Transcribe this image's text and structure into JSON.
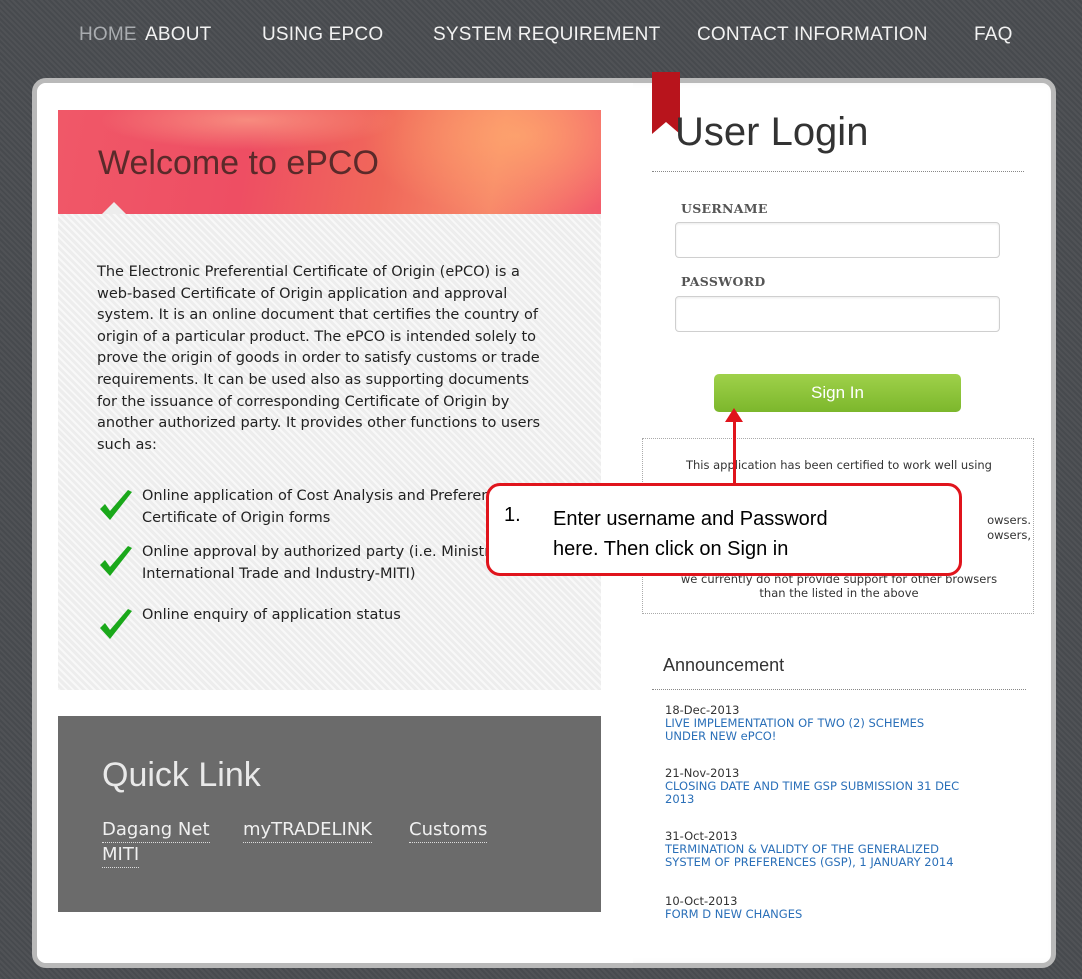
{
  "nav": {
    "items": [
      {
        "label": "HOME",
        "active": true
      },
      {
        "label": "ABOUT"
      },
      {
        "label": "USING EPCO"
      },
      {
        "label": "SYSTEM REQUIREMENT"
      },
      {
        "label": "CONTACT INFORMATION"
      },
      {
        "label": "FAQ"
      }
    ]
  },
  "welcome": {
    "title": "Welcome to ePCO",
    "lines": [
      "The Electronic Preferential Certificate of Origin (ePCO) is a",
      "web-based Certificate of Origin application and approval",
      "system. It is an online document that certifies the country of",
      "origin of a particular product. The ePCO is intended solely to",
      "prove the origin of goods in order to satisfy customs or trade",
      "requirements. It can be used also as supporting documents",
      "for the issuance of corresponding Certificate of Origin by",
      "another authorized party. It provides other functions to users",
      "such as:"
    ],
    "features": [
      {
        "line1": "Online application of Cost Analysis and Preferential",
        "line2": "Certificate of Origin forms"
      },
      {
        "line1": "Online approval by authorized party (i.e. Ministry of",
        "line2": "International Trade and Industry-MITI)"
      },
      {
        "line1": "Online enquiry of application status",
        "line2": ""
      }
    ]
  },
  "quick_link": {
    "title": "Quick Link",
    "links": [
      "Dagang Net",
      "myTRADELINK",
      "Customs",
      "MITI"
    ]
  },
  "login": {
    "title": "User Login",
    "username_label": "USERNAME",
    "username_value": "",
    "password_label": "PASSWORD",
    "password_value": "",
    "signin_label": "Sign In"
  },
  "notice": {
    "line1": "This application has been certified to work well using",
    "line2": "owsers.",
    "line3": "owsers,",
    "line4": "we currently do not provide support for other browsers",
    "line5": "than the listed in the above"
  },
  "announcement": {
    "title": "Announcement",
    "items": [
      {
        "date": "18-Dec-2013",
        "text1": "LIVE IMPLEMENTATION OF TWO (2) SCHEMES",
        "text2": "UNDER NEW ePCO!"
      },
      {
        "date": "21-Nov-2013",
        "text1": "CLOSING DATE AND TIME GSP SUBMISSION 31 DEC",
        "text2": "2013"
      },
      {
        "date": "31-Oct-2013",
        "text1": "TERMINATION & VALIDTY OF THE GENERALIZED",
        "text2": "SYSTEM OF PREFERENCES (GSP), 1 JANUARY 2014"
      },
      {
        "date": "10-Oct-2013",
        "text1": "FORM D NEW CHANGES",
        "text2": ""
      }
    ]
  },
  "callout": {
    "number": "1.",
    "line1": "Enter username and Password",
    "line2": "here. Then click on Sign in"
  },
  "colors": {
    "accent_green": "#8cc63f",
    "annotation_red": "#e0141c",
    "link_blue": "#2a6fb8",
    "check_green": "#1aa81a"
  }
}
